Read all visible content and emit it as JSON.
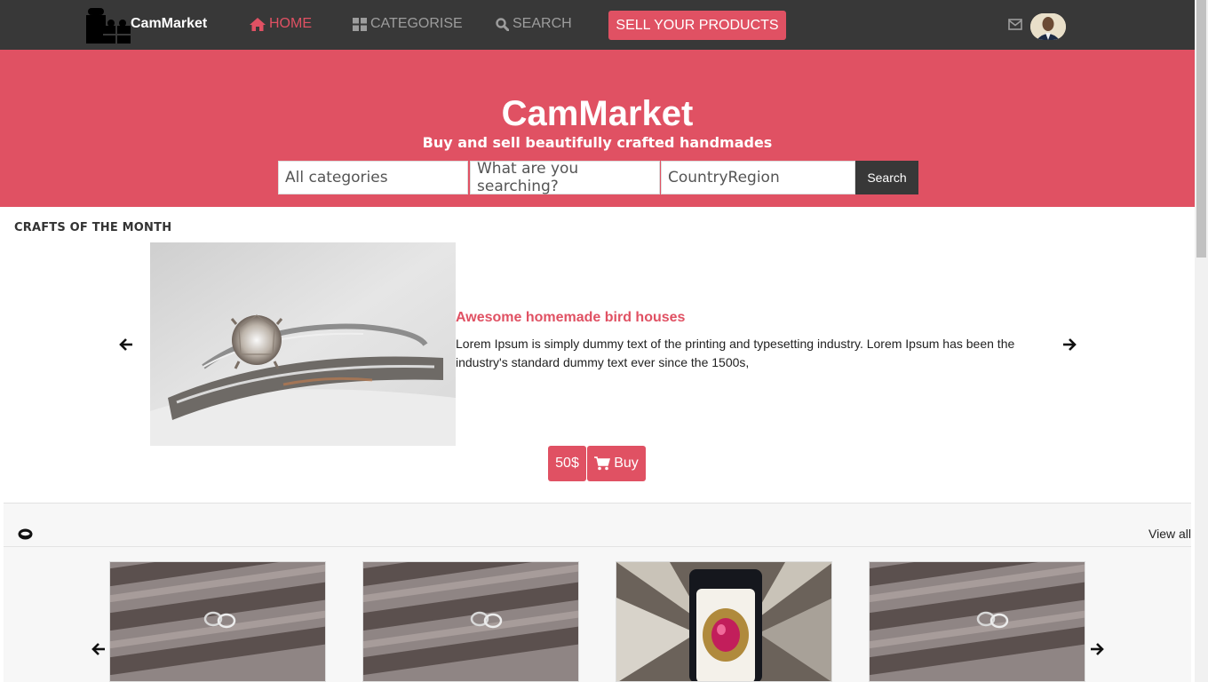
{
  "navbar": {
    "brand": "CamMarket",
    "links": [
      {
        "label": "HOME",
        "icon": "home-icon",
        "active": true
      },
      {
        "label": "CATEGORISE",
        "icon": "grid-icon",
        "active": false
      },
      {
        "label": "SEARCH",
        "icon": "search-icon",
        "active": false
      }
    ],
    "sell_label": "SELL YOUR PRODUCTS",
    "mail_icon": "envelope-icon",
    "avatar_icon": "user-avatar"
  },
  "hero": {
    "title": "CamMarket",
    "subtitle": "Buy and sell beautifully crafted handmades",
    "category_placeholder": "All categories",
    "search_placeholder": "What are you searching?",
    "country_placeholder": "CountryRegion",
    "search_button": "Search"
  },
  "crafts_of_month": {
    "section_title": "CRAFTS OF THE MONTH",
    "item_title": "Awesome homemade bird houses",
    "item_desc": "Lorem Ipsum is simply dummy text of the printing and typesetting industry. Lorem Ipsum has been the industry's standard dummy text ever since the 1500s,",
    "price": "50$",
    "buy_label": "Buy",
    "image": "diamond ring photo"
  },
  "category_strip": {
    "icon": "ring-category-icon",
    "view_all": "View all",
    "cards": [
      {
        "image": "wedding rings on wood"
      },
      {
        "image": "wedding rings on wood"
      },
      {
        "image": "ruby ring in box"
      },
      {
        "image": "wedding rings on wood"
      }
    ]
  },
  "colors": {
    "accent": "#e05163",
    "navbar": "#383838"
  }
}
